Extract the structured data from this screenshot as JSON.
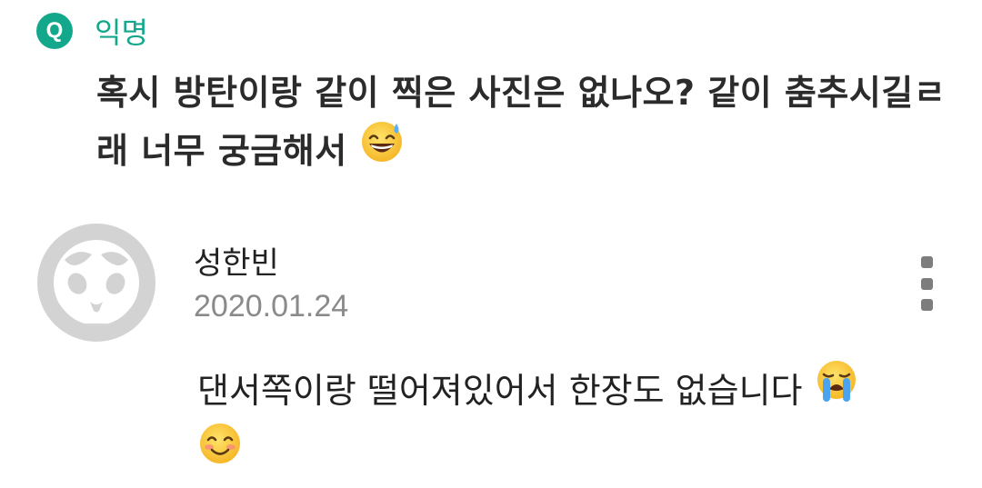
{
  "question": {
    "badge_label": "Q",
    "author": "익명",
    "text": "혹시 방탄이랑 같이 찍은 사진은 없나오? 같이 춤추시길ㄹ래 너무 궁금해서",
    "emoji_icon": "grinning-sweat-emoji-icon"
  },
  "answer": {
    "avatar_icon": "default-panda-avatar-icon",
    "name": "성한빈",
    "date": "2020.01.24",
    "text": "댄서쪽이랑 떨어져있어서 한장도 없습니다",
    "emoji_icons": [
      "loudly-crying-emoji-icon",
      "smiling-blush-emoji-icon"
    ],
    "more_icon": "more-vertical-icon"
  },
  "colors": {
    "accent": "#13a88b",
    "date_gray": "#8a8a8a",
    "avatar_bg": "#d3d3d3"
  }
}
